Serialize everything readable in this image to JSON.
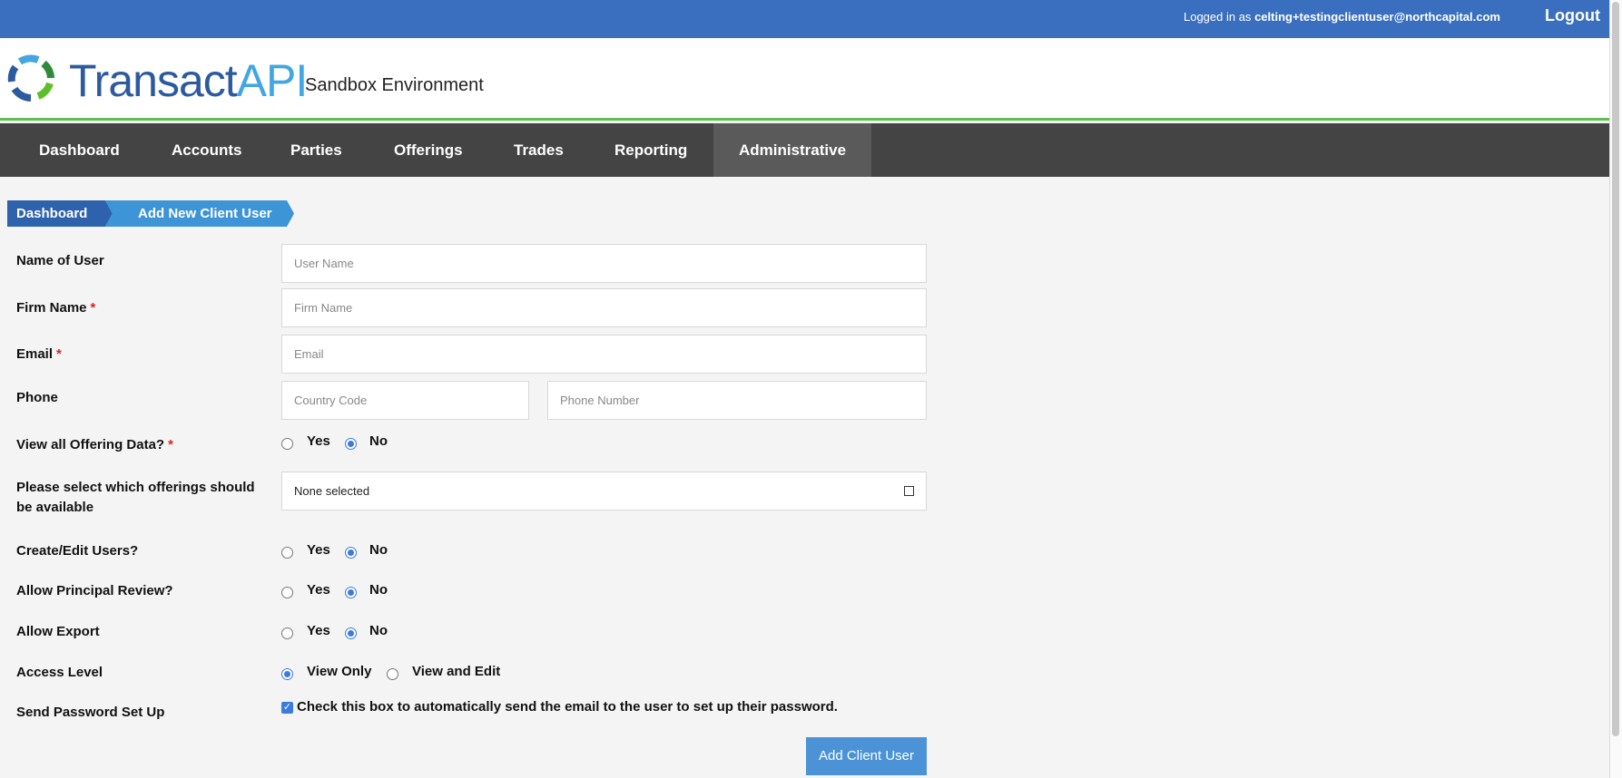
{
  "topbar": {
    "logged_in_prefix": "Logged in as ",
    "user_email": "celting+testingclientuser@northcapital.com",
    "logout": "Logout"
  },
  "header": {
    "logo_main": "Transact",
    "logo_accent": "API",
    "environment": "Sandbox Environment"
  },
  "nav": [
    "Dashboard",
    "Accounts",
    "Parties",
    "Offerings",
    "Trades",
    "Reporting",
    "Administrative"
  ],
  "breadcrumb": [
    "Dashboard",
    "Add New Client User"
  ],
  "form": {
    "name_label": "Name of User",
    "name_placeholder": "User Name",
    "firm_label": "Firm Name",
    "firm_placeholder": "Firm Name",
    "email_label": "Email",
    "email_placeholder": "Email",
    "phone_label": "Phone",
    "country_placeholder": "Country Code",
    "phone_placeholder": "Phone Number",
    "required_mark": "*",
    "view_all_label": "View all Offering Data?",
    "offerings_label": "Please select which offerings should be available",
    "offerings_value": "None selected",
    "create_edit_label": "Create/Edit Users?",
    "principal_label": "Allow Principal Review?",
    "export_label": "Allow Export",
    "access_label": "Access Level",
    "view_only": "View Only",
    "view_edit": "View and Edit",
    "send_pw_label": "Send Password Set Up",
    "send_pw_text": "Check this box to automatically send the email to the user to set up their password.",
    "yes": "Yes",
    "no": "No",
    "submit": "Add Client User"
  },
  "colors": {
    "topbar": "#3a6fc0",
    "nav": "#444444",
    "accent_green": "#5cbf4f",
    "button": "#4b93d6"
  }
}
